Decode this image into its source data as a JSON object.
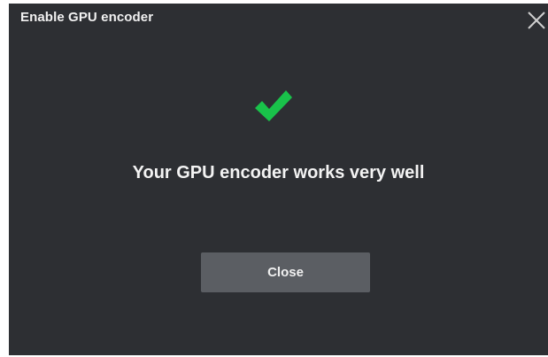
{
  "dialog": {
    "title": "Enable GPU encoder",
    "message": "Your GPU encoder works very well",
    "close_button_label": "Close",
    "icons": {
      "status": "checkmark-icon",
      "close": "close-icon"
    },
    "colors": {
      "background": "#2d2f33",
      "success": "#19c24a",
      "button": "#5b5e63",
      "text": "#f3f3f3"
    }
  }
}
